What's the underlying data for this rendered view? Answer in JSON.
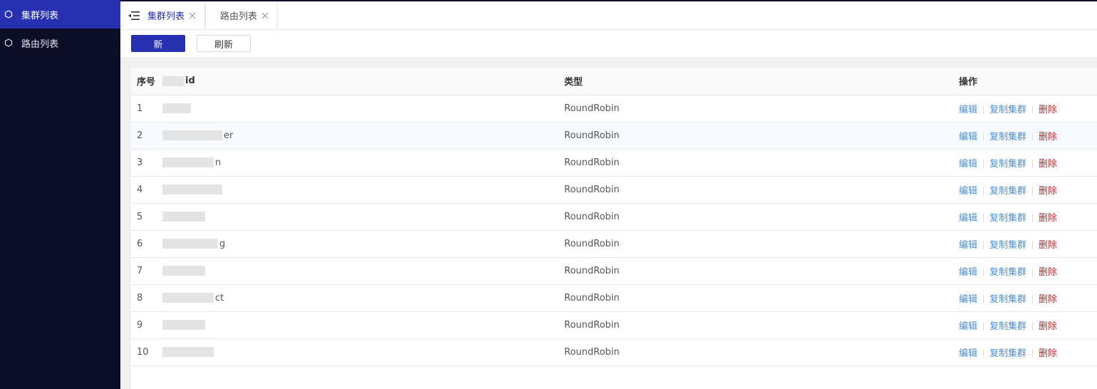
{
  "sidebar": {
    "items": [
      {
        "label": "集群列表",
        "active": true
      },
      {
        "label": "路由列表",
        "active": false
      }
    ]
  },
  "tabs": [
    {
      "label": "集群列表",
      "active": true
    },
    {
      "label": "路由列表",
      "active": false
    }
  ],
  "toolbar": {
    "add_label": "新",
    "refresh_label": "刷新"
  },
  "table": {
    "headers": {
      "index": "序号",
      "id": "id",
      "type": "类型",
      "ops": "操作"
    },
    "rows": [
      {
        "index": "1",
        "id_tail": "",
        "type": "RoundRobin"
      },
      {
        "index": "2",
        "id_tail": "er",
        "type": "RoundRobin"
      },
      {
        "index": "3",
        "id_tail": "n",
        "type": "RoundRobin"
      },
      {
        "index": "4",
        "id_tail": "",
        "type": "RoundRobin"
      },
      {
        "index": "5",
        "id_tail": "",
        "type": "RoundRobin"
      },
      {
        "index": "6",
        "id_tail": "g",
        "type": "RoundRobin"
      },
      {
        "index": "7",
        "id_tail": "",
        "type": "RoundRobin"
      },
      {
        "index": "8",
        "id_tail": "ct",
        "type": "RoundRobin"
      },
      {
        "index": "9",
        "id_tail": "",
        "type": "RoundRobin"
      },
      {
        "index": "10",
        "id_tail": "",
        "type": "RoundRobin"
      }
    ],
    "actions": {
      "edit": "编辑",
      "copy": "复制集群",
      "delete": "删除"
    }
  },
  "colors": {
    "sidebar_bg": "#0c0d26",
    "accent": "#2630b0",
    "link": "#4a8fd6",
    "danger": "#c62828"
  },
  "icons": {
    "sidebar_item": "hexagon-icon",
    "tab_toggle": "menu-fold-icon",
    "tab_close": "close-icon"
  }
}
